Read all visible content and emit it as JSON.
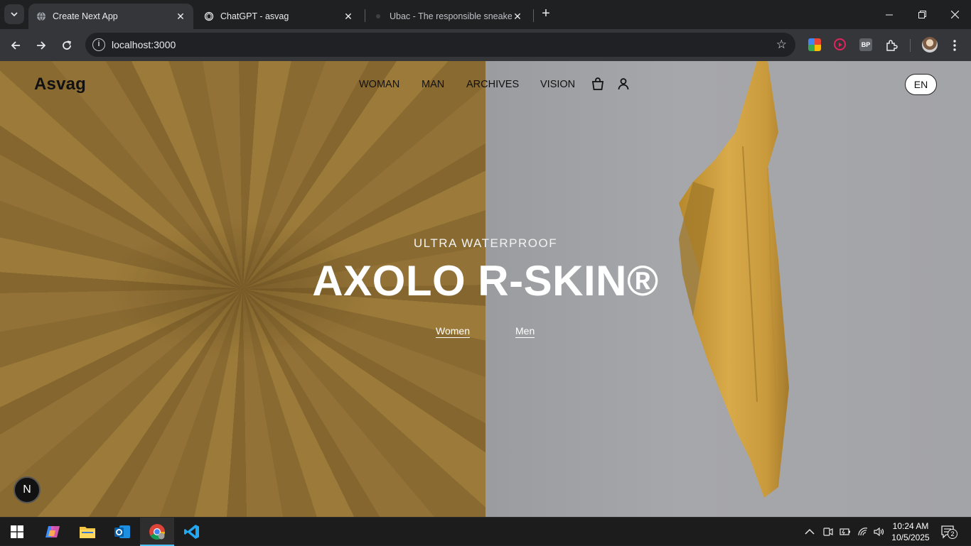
{
  "browser": {
    "tabs": [
      {
        "title": "Create Next App",
        "active": true
      },
      {
        "title": "ChatGPT - asvag",
        "active": false
      },
      {
        "title": "Ubac - The responsible sneaker",
        "active": false
      }
    ],
    "url": "localhost:3000",
    "extensions": [
      "colorful-ext-icon",
      "record-ext-icon",
      "bp-ext-icon",
      "puzzle-icon"
    ],
    "bp_label": "BP"
  },
  "site": {
    "brand": "Asvag",
    "nav": [
      "WOMAN",
      "MAN",
      "ARCHIVES",
      "VISION"
    ],
    "language": "EN",
    "hero": {
      "eyebrow": "ULTRA WATERPROOF",
      "headline": "AXOLO R-SKIN®",
      "cta_women": "Women",
      "cta_men": "Men"
    },
    "next_badge": "N"
  },
  "taskbar": {
    "time": "10:24 AM",
    "date": "10/5/2025",
    "notifications": "2"
  },
  "colors": {
    "fabric_gold": "#9a7a3e",
    "background_gray": "#a4a5a9",
    "taskbar": "#1c1c1c",
    "chrome_dark": "#202124"
  }
}
